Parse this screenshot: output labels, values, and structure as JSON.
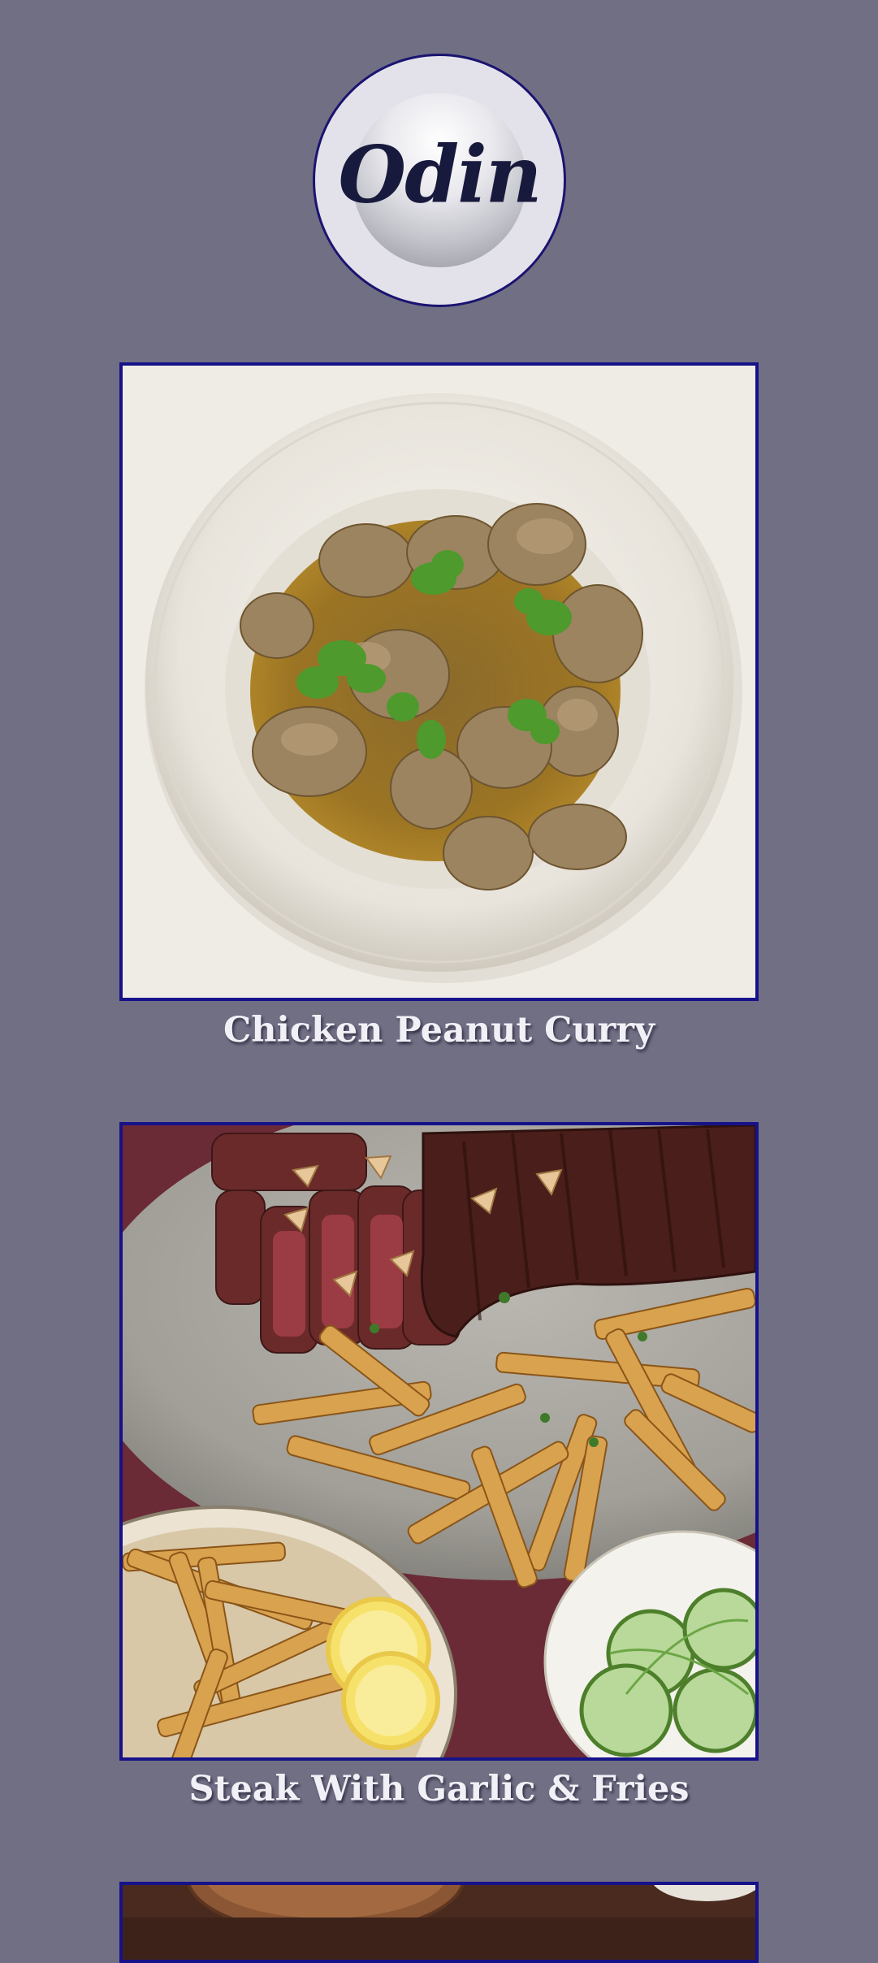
{
  "logo": {
    "text": "Odin"
  },
  "recipes": [
    {
      "title": "Chicken Peanut Curry"
    },
    {
      "title": "Steak With Garlic & Fries"
    },
    {
      "title": ""
    }
  ],
  "colors": {
    "background": "#716f84",
    "frame_border": "#16128a",
    "caption_text": "#f1f0f6"
  }
}
